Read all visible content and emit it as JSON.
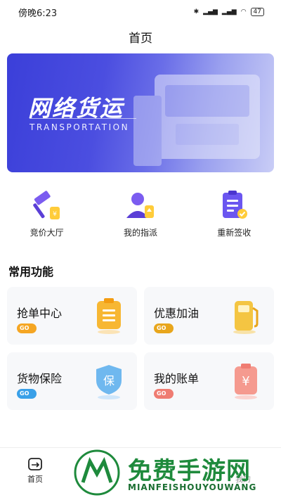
{
  "status_bar": {
    "time": "傍晚6:23",
    "battery": "47"
  },
  "page": {
    "title": "首页"
  },
  "banner": {
    "title": "网络货运",
    "subtitle": "TRANSPORTATION"
  },
  "quick_actions": [
    {
      "label": "竞价大厅",
      "icon": "gavel-icon"
    },
    {
      "label": "我的指派",
      "icon": "user-assign-icon"
    },
    {
      "label": "重新签收",
      "icon": "clipboard-check-icon"
    }
  ],
  "section": {
    "title": "常用功能"
  },
  "cards": [
    {
      "title": "抢单中心",
      "go": "GO",
      "icon": "order-document-icon",
      "accent": "#f5a623"
    },
    {
      "title": "优惠加油",
      "go": "GO",
      "icon": "fuel-pump-icon",
      "accent": "#e8a61c"
    },
    {
      "title": "货物保险",
      "go": "GO",
      "icon": "shield-insurance-icon",
      "accent": "#3aa0e8"
    },
    {
      "title": "我的账单",
      "go": "GO",
      "icon": "bill-yen-icon",
      "accent": "#ef7c72"
    }
  ],
  "bottom_nav": {
    "home_label": "首页",
    "mine_label": "我的"
  },
  "watermark": {
    "text": "免费手游网",
    "sub": "MIANFEISHOUYOUWANG"
  }
}
